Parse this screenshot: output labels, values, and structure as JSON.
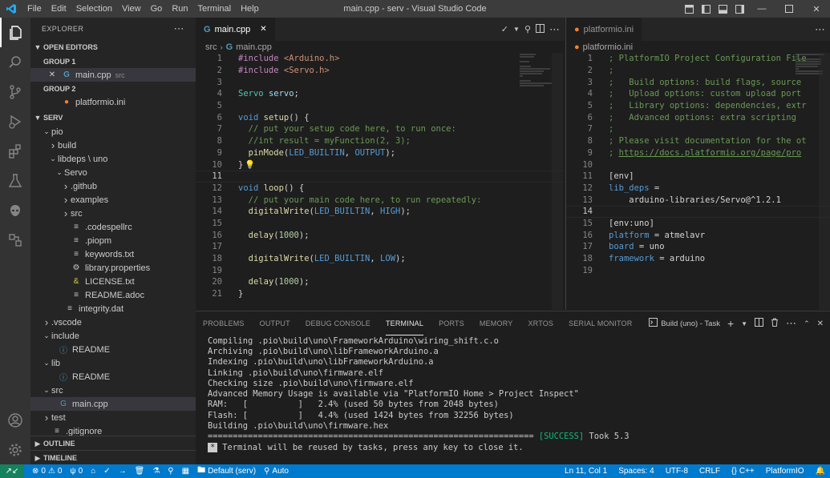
{
  "window": {
    "title": "main.cpp - serv - Visual Studio Code",
    "menu": [
      "File",
      "Edit",
      "Selection",
      "View",
      "Go",
      "Run",
      "Terminal",
      "Help"
    ]
  },
  "sidebar": {
    "header": "EXPLORER",
    "open_editors": {
      "label": "OPEN EDITORS",
      "group1": "GROUP 1",
      "group1_file": "main.cpp",
      "group1_desc": "src",
      "group2": "GROUP 2",
      "group2_file": "platformio.ini"
    },
    "workspace": {
      "label": "SERV",
      "items": [
        {
          "label": "pio",
          "depth": 1,
          "kind": "folder-open"
        },
        {
          "label": "build",
          "depth": 2,
          "kind": "folder"
        },
        {
          "label": "libdeps \\ uno",
          "depth": 2,
          "kind": "folder-open"
        },
        {
          "label": "Servo",
          "depth": 3,
          "kind": "folder-open"
        },
        {
          "label": ".github",
          "depth": 4,
          "kind": "folder"
        },
        {
          "label": "examples",
          "depth": 4,
          "kind": "folder"
        },
        {
          "label": "src",
          "depth": 4,
          "kind": "folder"
        },
        {
          "label": ".codespellrc",
          "depth": 4,
          "kind": "file"
        },
        {
          "label": ".piopm",
          "depth": 4,
          "kind": "file"
        },
        {
          "label": "keywords.txt",
          "depth": 4,
          "kind": "file"
        },
        {
          "label": "library.properties",
          "depth": 4,
          "kind": "gear"
        },
        {
          "label": "LICENSE.txt",
          "depth": 4,
          "kind": "license"
        },
        {
          "label": "README.adoc",
          "depth": 4,
          "kind": "file"
        },
        {
          "label": "integrity.dat",
          "depth": 3,
          "kind": "file"
        },
        {
          "label": ".vscode",
          "depth": 1,
          "kind": "folder"
        },
        {
          "label": "include",
          "depth": 1,
          "kind": "folder-open"
        },
        {
          "label": "README",
          "depth": 2,
          "kind": "info"
        },
        {
          "label": "lib",
          "depth": 1,
          "kind": "folder-open"
        },
        {
          "label": "README",
          "depth": 2,
          "kind": "info"
        },
        {
          "label": "src",
          "depth": 1,
          "kind": "folder-open"
        },
        {
          "label": "main.cpp",
          "depth": 2,
          "kind": "cpp",
          "selected": true
        },
        {
          "label": "test",
          "depth": 1,
          "kind": "folder"
        },
        {
          "label": ".gitignore",
          "depth": 1,
          "kind": "file"
        }
      ]
    },
    "outline": "OUTLINE",
    "timeline": "TIMELINE"
  },
  "editor1": {
    "tab": "main.cpp",
    "crumbs": [
      "src",
      "main.cpp"
    ],
    "lines": [
      [
        "1",
        "#include <Arduino.h>"
      ],
      [
        "2",
        "#include <Servo.h>"
      ],
      [
        "3",
        ""
      ],
      [
        "4",
        "Servo servo;"
      ],
      [
        "5",
        ""
      ],
      [
        "6",
        "void setup() {"
      ],
      [
        "7",
        "  // put your setup code here, to run once:"
      ],
      [
        "8",
        "  //int result = myFunction(2, 3);"
      ],
      [
        "9",
        "  pinMode(LED_BUILTIN, OUTPUT);"
      ],
      [
        "10",
        "}"
      ],
      [
        "11",
        ""
      ],
      [
        "12",
        "void loop() {"
      ],
      [
        "13",
        "  // put your main code here, to run repeatedly:"
      ],
      [
        "14",
        "  digitalWrite(LED_BUILTIN, HIGH);"
      ],
      [
        "15",
        ""
      ],
      [
        "16",
        "  delay(1000);"
      ],
      [
        "17",
        ""
      ],
      [
        "18",
        "  digitalWrite(LED_BUILTIN, LOW);"
      ],
      [
        "19",
        ""
      ],
      [
        "20",
        "  delay(1000);"
      ],
      [
        "21",
        "}"
      ]
    ]
  },
  "editor2": {
    "tab": "platformio.ini",
    "crumbs": [
      "platformio.ini"
    ],
    "lines": [
      [
        "1",
        "; PlatformIO Project Configuration File"
      ],
      [
        "2",
        ";"
      ],
      [
        "3",
        ";   Build options: build flags, source"
      ],
      [
        "4",
        ";   Upload options: custom upload port"
      ],
      [
        "5",
        ";   Library options: dependencies, extr"
      ],
      [
        "6",
        ";   Advanced options: extra scripting"
      ],
      [
        "7",
        ";"
      ],
      [
        "8",
        "; Please visit documentation for the ot"
      ],
      [
        "9",
        "; https://docs.platformio.org/page/pro"
      ],
      [
        "10",
        ""
      ],
      [
        "11",
        "[env]"
      ],
      [
        "12",
        "lib_deps ="
      ],
      [
        "13",
        "    arduino-libraries/Servo@^1.2.1"
      ],
      [
        "14",
        ""
      ],
      [
        "15",
        "[env:uno]"
      ],
      [
        "16",
        "platform = atmelavr"
      ],
      [
        "17",
        "board = uno"
      ],
      [
        "18",
        "framework = arduino"
      ],
      [
        "19",
        ""
      ]
    ]
  },
  "panel": {
    "tabs": [
      "PROBLEMS",
      "OUTPUT",
      "DEBUG CONSOLE",
      "TERMINAL",
      "PORTS",
      "MEMORY",
      "XRTOS",
      "SERIAL MONITOR"
    ],
    "active_tab": "TERMINAL",
    "task_label": "Build (uno) - Task",
    "terminal_lines": [
      "Compiling .pio\\build\\uno\\FrameworkArduino\\wiring_shift.c.o",
      "Archiving .pio\\build\\uno\\libFrameworkArduino.a",
      "Indexing .pio\\build\\uno\\libFrameworkArduino.a",
      "Linking .pio\\build\\uno\\firmware.elf",
      "Checking size .pio\\build\\uno\\firmware.elf",
      "Advanced Memory Usage is available via \"PlatformIO Home > Project Inspect\"",
      "RAM:   [          ]   2.4% (used 50 bytes from 2048 bytes)",
      "Flash: [          ]   4.4% (used 1424 bytes from 32256 bytes)",
      "Building .pio\\build\\uno\\firmware.hex"
    ],
    "success_prefix": "=============================================================================== ",
    "success_word": "[SUCCESS]",
    "success_suffix": " Took 5.3",
    "reuse_marker": "*",
    "reuse_text": "Terminal will be reused by tasks, press any key to close it."
  },
  "statusbar": {
    "errors": "0",
    "warnings": "0",
    "remote_count": "0",
    "env": "Default (serv)",
    "auto": "Auto",
    "position": "Ln 11, Col 1",
    "spaces": "Spaces: 4",
    "encoding": "UTF-8",
    "eol": "CRLF",
    "language": "C++",
    "platform": "PlatformIO"
  }
}
